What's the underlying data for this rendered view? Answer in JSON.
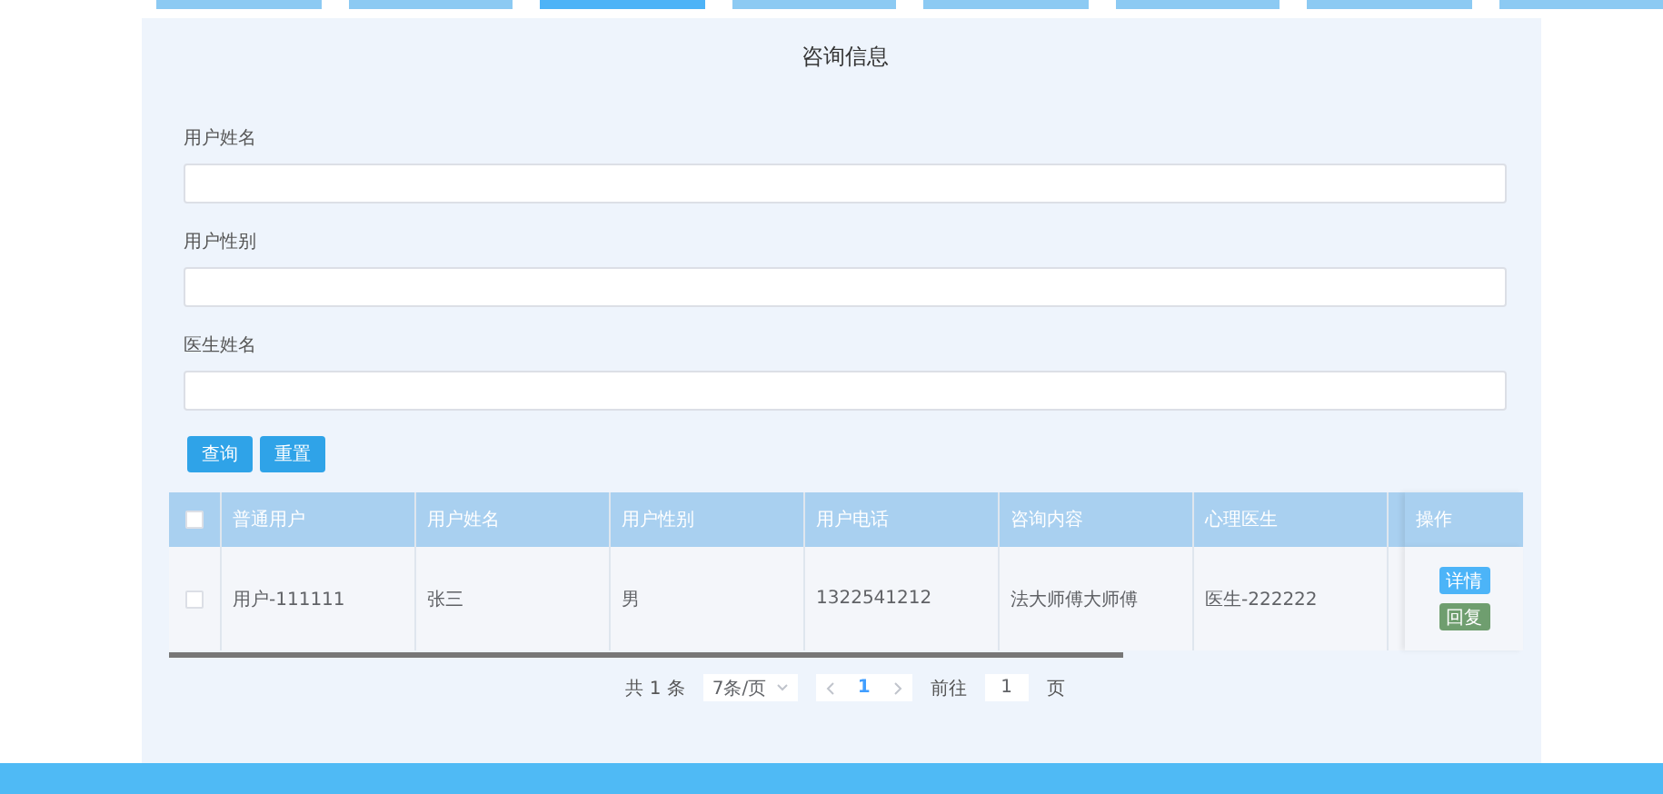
{
  "nav_tabs": [
    {
      "selected": false
    },
    {
      "selected": false
    },
    {
      "selected": true
    },
    {
      "selected": false
    },
    {
      "selected": false
    },
    {
      "selected": false
    },
    {
      "selected": false
    },
    {
      "selected": false
    }
  ],
  "title": "咨询信息",
  "filters": [
    {
      "label": "用户姓名"
    },
    {
      "label": "用户性别"
    },
    {
      "label": "医生姓名"
    }
  ],
  "buttons": [
    {
      "label": "查询"
    },
    {
      "label": "重置"
    }
  ],
  "table": {
    "select_all_checked": false,
    "columns": [
      "普通用户",
      "用户姓名",
      "用户性别",
      "用户电话",
      "咨询内容",
      "心理医生"
    ],
    "action_column": "操作",
    "rows": [
      {
        "checked": false,
        "cells": [
          "用户-111111",
          "张三",
          "男",
          "1322541212",
          "法大师傅大师傅",
          "医生-222222"
        ],
        "actions": [
          {
            "label": "详情",
            "kind": "primary"
          },
          {
            "label": "回复",
            "kind": "success"
          }
        ]
      }
    ]
  },
  "pagination": {
    "total": "共 1 条",
    "page_size": "7条/页",
    "pages": [
      {
        "label": "1",
        "selected": true
      }
    ],
    "goto_label": "前往",
    "goto_value": "1",
    "goto_suffix": "页"
  }
}
